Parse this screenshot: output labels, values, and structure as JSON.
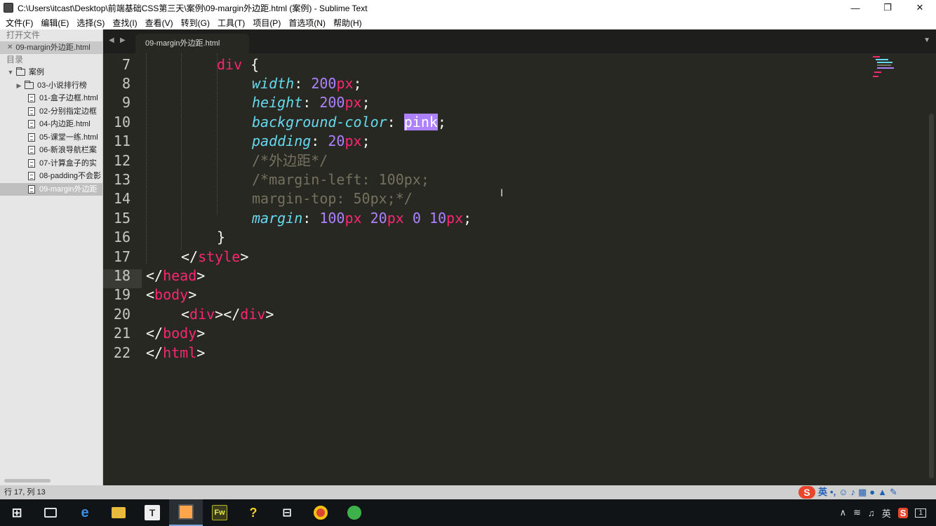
{
  "window": {
    "title": "C:\\Users\\itcast\\Desktop\\前端基础CSS第三天\\案例\\09-margin外边距.html (案例) - Sublime Text",
    "minimize": "—",
    "restore": "❐",
    "close": "✕"
  },
  "menu": [
    "文件(F)",
    "编辑(E)",
    "选择(S)",
    "查找(I)",
    "查看(V)",
    "转到(G)",
    "工具(T)",
    "项目(P)",
    "首选项(N)",
    "帮助(H)"
  ],
  "sidebar": {
    "open_files_heading": "打开文件",
    "open_file": "09-margin外边距.html",
    "folders_heading": "目录",
    "root_folder": "案例",
    "subfolder": "03-小说排行榜",
    "files": [
      "01-盒子边框.html",
      "02-分别指定边框",
      "04-内边距.html",
      "05-课堂一练.html",
      "06-新浪导航栏案",
      "07-计算盒子的实",
      "08-padding不会影",
      "09-margin外边距"
    ],
    "selected_file_index": 7
  },
  "tab": {
    "label": "09-margin外边距.html"
  },
  "editor": {
    "line_numbers": [
      "7",
      "8",
      "9",
      "10",
      "11",
      "12",
      "13",
      "14",
      "15",
      "16",
      "17",
      "18",
      "19",
      "20",
      "21",
      "22"
    ],
    "active_line": "17",
    "code": {
      "l7_sel": "div",
      "l7_brace": " {",
      "l8_prop": "width",
      "l8_colon": ": ",
      "l8_num": "200",
      "l8_unit": "px",
      "l8_semi": ";",
      "l9_prop": "height",
      "l9_colon": ": ",
      "l9_num": "200",
      "l9_unit": "px",
      "l9_semi": ";",
      "l10_prop": "background-color",
      "l10_colon": ": ",
      "l10_val": "pink",
      "l10_semi": ";",
      "l11_prop": "padding",
      "l11_colon": ": ",
      "l11_num": "20",
      "l11_unit": "px",
      "l11_semi": ";",
      "l12_cmt": "/*外边距*/",
      "l13_cmt": "/*margin-left: 100px;",
      "l14_cmt": "margin-top: 50px;*/",
      "l15_prop": "margin",
      "l15_colon": ": ",
      "l15_n1": "100",
      "l15_u1": "px",
      "l15_n2": "20",
      "l15_u2": "px",
      "l15_n3": "0",
      "l15_n4": "10",
      "l15_u4": "px",
      "l15_semi": ";",
      "l16": "}",
      "l17_open": "</",
      "l17_tag": "style",
      "l17_close": ">",
      "l18_open": "</",
      "l18_tag": "head",
      "l18_close": ">",
      "l19_open": "<",
      "l19_tag": "body",
      "l19_close": ">",
      "l20_open": "<",
      "l20_tag": "div",
      "l20_mid": "></",
      "l20_tag2": "div",
      "l20_close": ">",
      "l21_open": "</",
      "l21_tag": "body",
      "l21_close": ">",
      "l22_open": "</",
      "l22_tag": "html",
      "l22_close": ">"
    }
  },
  "statusbar": {
    "position": "行 17, 列 13",
    "ime_logo": "S",
    "ime_lang": "英"
  },
  "taskbar": {
    "apps": [
      "start-icon",
      "task-view-icon",
      "edge-icon",
      "file-explorer-icon",
      "typora-icon",
      "sublime-text-icon",
      "fireworks-icon",
      "help-icon",
      "network-tool-icon",
      "chrome-icon",
      "green-app-icon"
    ],
    "fireworks_label": "Fw",
    "tray_lang": "英",
    "tray_notification": "1"
  },
  "colors": {
    "editor_bg": "#272822",
    "keyword_pink": "#f92672",
    "property_cyan": "#66d9ef",
    "number_purple": "#ae81ff",
    "comment_gray": "#75715e"
  }
}
